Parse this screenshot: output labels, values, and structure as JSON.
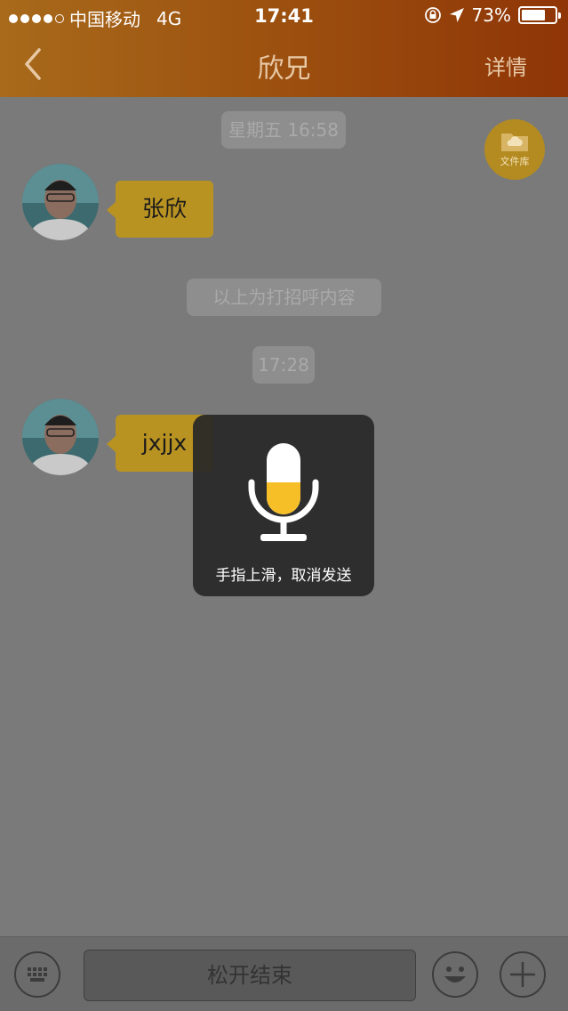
{
  "status_bar": {
    "carrier": "中国移动",
    "network": "4G",
    "time": "17:41",
    "battery_percent_label": "73%",
    "battery_level": 0.73
  },
  "nav": {
    "title": "欣兄",
    "detail_label": "详情"
  },
  "file_library": {
    "label": "文件库"
  },
  "messages": [
    {
      "type": "timestamp",
      "text": "星期五 16:58"
    },
    {
      "type": "incoming",
      "text": "张欣"
    },
    {
      "type": "system",
      "text": "以上为打招呼内容"
    },
    {
      "type": "timestamp",
      "text": "17:28"
    },
    {
      "type": "incoming",
      "text": "jxjjx"
    }
  ],
  "recording": {
    "hint": "手指上滑，取消发送",
    "level": 0.45
  },
  "input_bar": {
    "release_label": "松开结束"
  },
  "colors": {
    "header_start": "#a86a1b",
    "header_end": "#8f3507",
    "bubble": "#b99322",
    "mic_level": "#f7bf27"
  }
}
